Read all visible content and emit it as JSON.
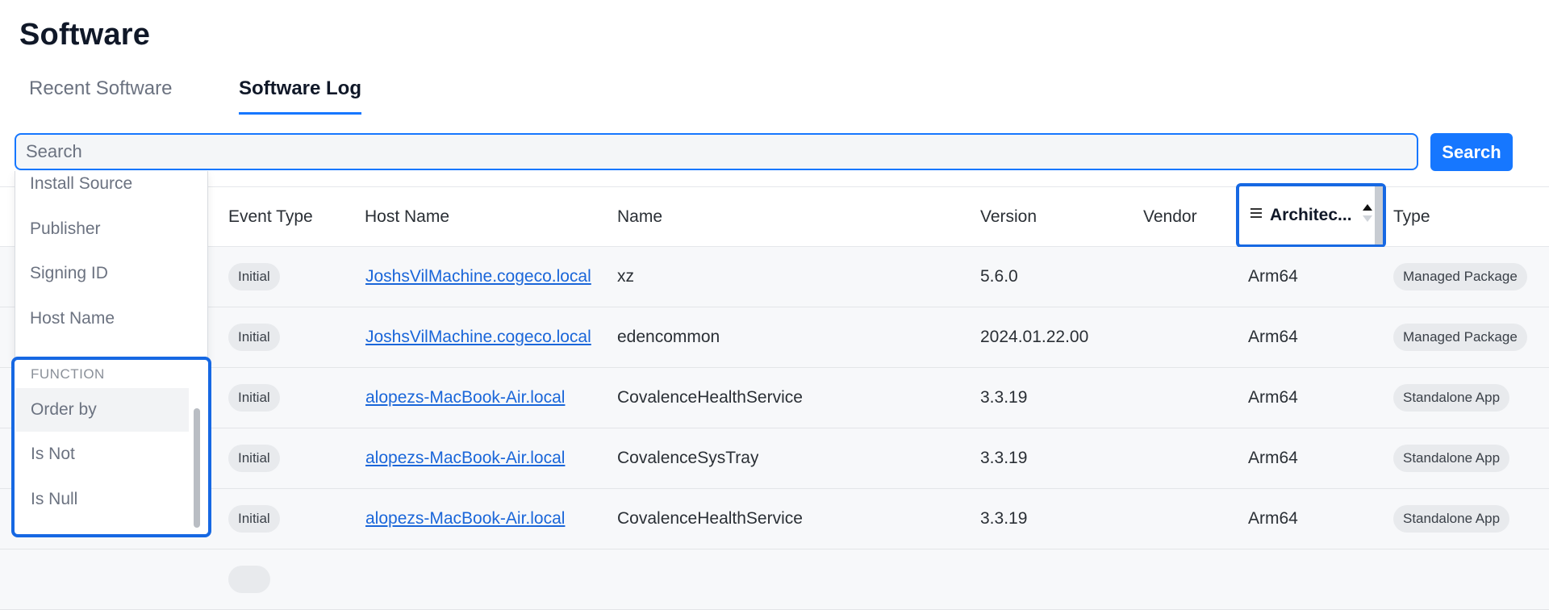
{
  "page": {
    "title": "Software"
  },
  "tabs": [
    {
      "label": "Recent Software",
      "active": false
    },
    {
      "label": "Software Log",
      "active": true
    }
  ],
  "search": {
    "placeholder": "Search",
    "value": "",
    "button_label": "Search"
  },
  "table": {
    "columns": {
      "event_type": "Event Type",
      "host_name": "Host Name",
      "name": "Name",
      "version": "Version",
      "vendor": "Vendor",
      "architecture": "Architec...",
      "type": "Type"
    },
    "architecture_sort": "ascending",
    "rows": [
      {
        "event_type": "Initial",
        "host_name": "JoshsVilMachine.cogeco.local",
        "name": "xz",
        "version": "5.6.0",
        "vendor": "",
        "architecture": "Arm64",
        "type": "Managed Package"
      },
      {
        "event_type": "Initial",
        "host_name": "JoshsVilMachine.cogeco.local",
        "name": "edencommon",
        "version": "2024.01.22.00",
        "vendor": "",
        "architecture": "Arm64",
        "type": "Managed Package"
      },
      {
        "event_type": "Initial",
        "host_name": "alopezs-MacBook-Air.local",
        "name": "CovalenceHealthService",
        "version": "3.3.19",
        "vendor": "",
        "architecture": "Arm64",
        "type": "Standalone App"
      },
      {
        "event_type": "Initial",
        "host_name": "alopezs-MacBook-Air.local",
        "name": "CovalenceSysTray",
        "version": "3.3.19",
        "vendor": "",
        "architecture": "Arm64",
        "type": "Standalone App"
      },
      {
        "event_type": "Initial",
        "host_name": "alopezs-MacBook-Air.local",
        "name": "CovalenceHealthService",
        "version": "3.3.19",
        "vendor": "",
        "architecture": "Arm64",
        "type": "Standalone App"
      }
    ]
  },
  "dropdown": {
    "field_items": [
      "Install Source",
      "Publisher",
      "Signing ID",
      "Host Name"
    ],
    "function_heading": "FUNCTION",
    "function_items": [
      "Order by",
      "Is Not",
      "Is Null"
    ],
    "highlighted_function": "Order by"
  },
  "colors": {
    "accent": "#1677ff",
    "link": "#1a66d9",
    "badge_bg": "#e8eaed",
    "row_bg": "#f7f8fa"
  },
  "icons": {
    "architecture_header": [
      "menu-icon",
      "sort-icon"
    ]
  }
}
